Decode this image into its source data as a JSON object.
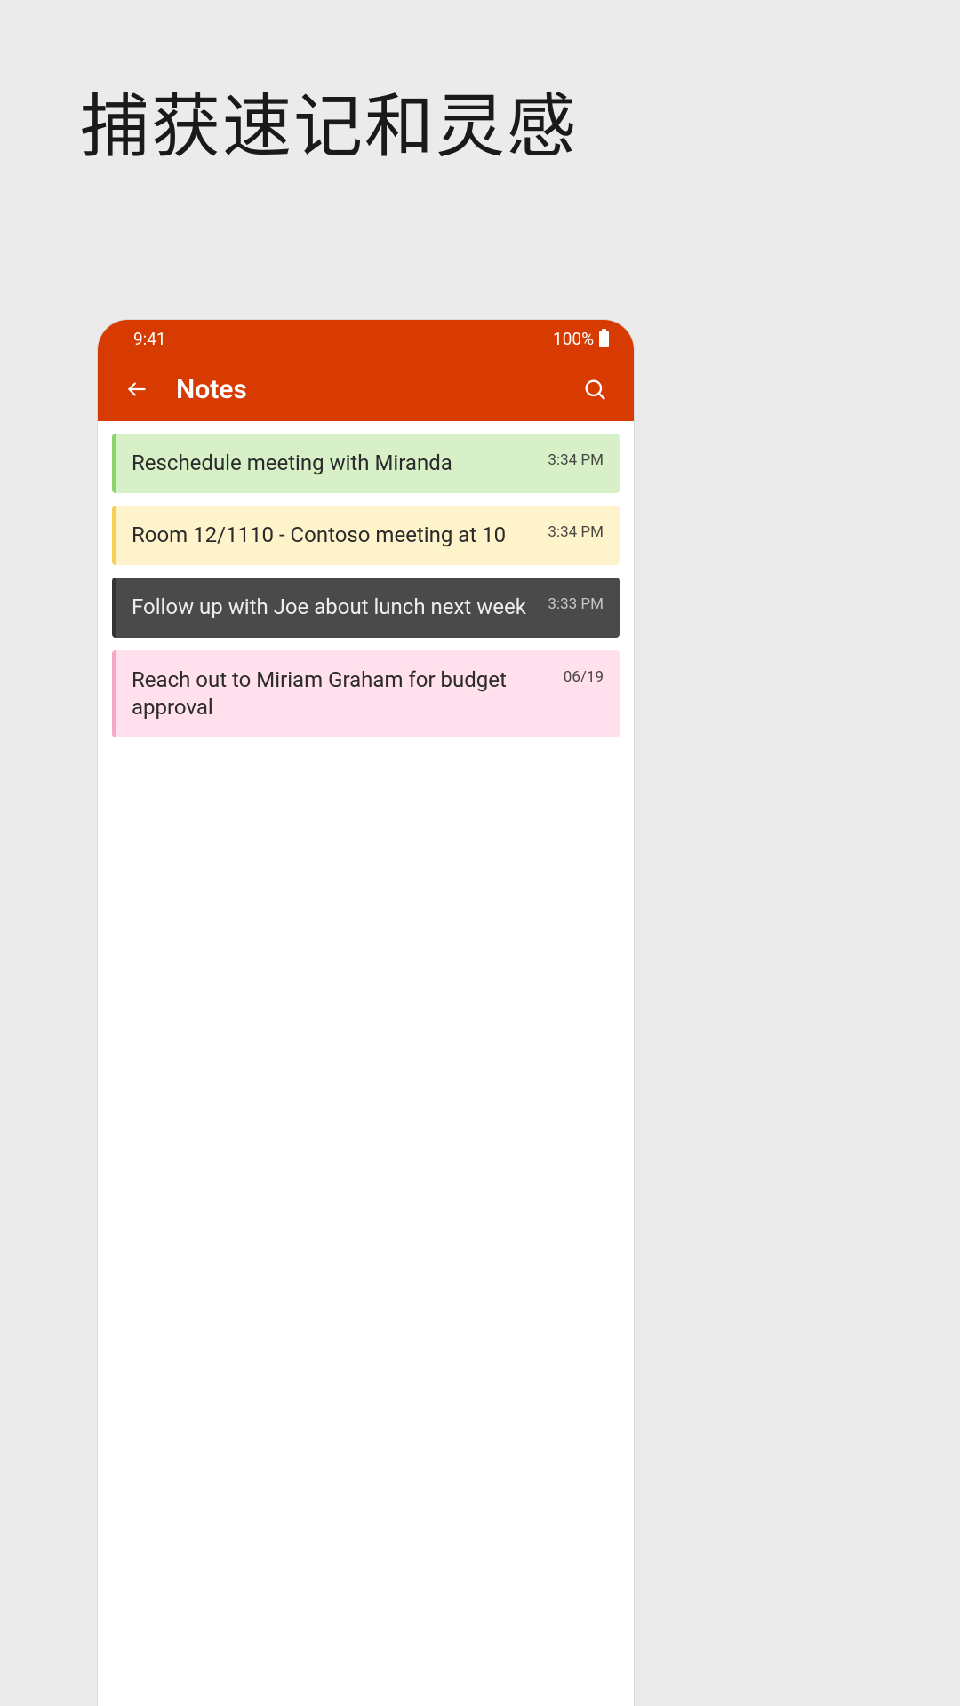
{
  "headline": "捕获速记和灵感",
  "statusbar": {
    "time": "9:41",
    "battery": "100%"
  },
  "appbar": {
    "title": "Notes"
  },
  "notes": [
    {
      "title": "Reschedule meeting with Miranda",
      "time": "3:34 PM",
      "color": "green"
    },
    {
      "title": "Room 12/1110 - Contoso meeting at 10",
      "time": "3:34 PM",
      "color": "yellow"
    },
    {
      "title": "Follow up with Joe about lunch next week",
      "time": "3:33 PM",
      "color": "dark"
    },
    {
      "title": "Reach out to Miriam Graham for budget approval",
      "time": "06/19",
      "color": "pink"
    }
  ]
}
